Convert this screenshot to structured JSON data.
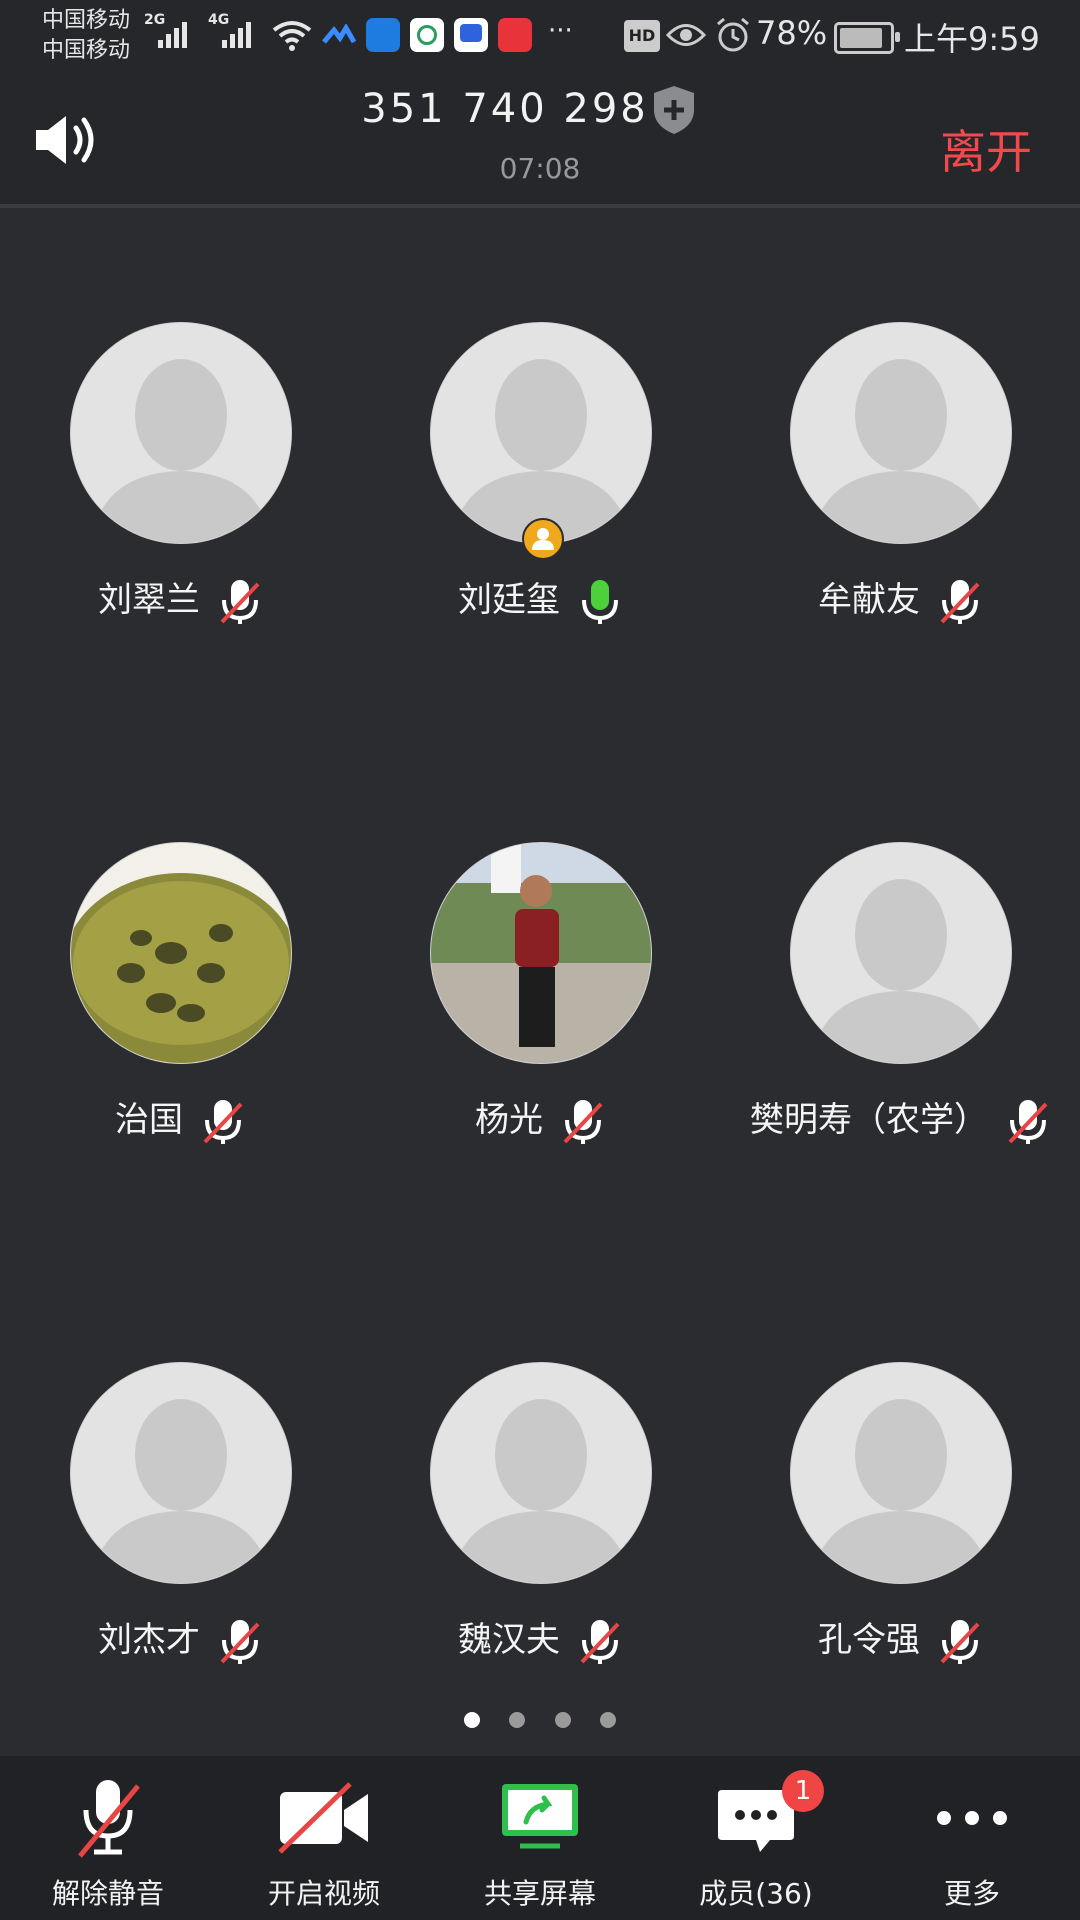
{
  "status_bar": {
    "carrier_1": "中国移动",
    "carrier_2": "中国移动",
    "net_1": "2G",
    "net_2": "4G",
    "battery": "78%",
    "time": "上午9:59",
    "hd": "HD"
  },
  "header": {
    "meeting_id": "351 740 298",
    "duration": "07:08",
    "leave_label": "离开"
  },
  "participants": [
    {
      "name": "刘翠兰",
      "mic": "muted",
      "avatar": "default"
    },
    {
      "name": "刘廷玺",
      "mic": "active",
      "avatar": "default",
      "host": true
    },
    {
      "name": "牟献友",
      "mic": "muted",
      "avatar": "default"
    },
    {
      "name": "治国",
      "mic": "muted",
      "avatar": "photo-tea"
    },
    {
      "name": "杨光",
      "mic": "muted",
      "avatar": "photo-man"
    },
    {
      "name": "樊明寿（农学）",
      "mic": "muted",
      "avatar": "default"
    },
    {
      "name": "刘杰才",
      "mic": "muted",
      "avatar": "default"
    },
    {
      "name": "魏汉夫",
      "mic": "muted",
      "avatar": "default"
    },
    {
      "name": "孔令强",
      "mic": "muted",
      "avatar": "default"
    }
  ],
  "pagination": {
    "pages": 4,
    "current": 1
  },
  "toolbar": {
    "unmute": "解除静音",
    "video": "开启视频",
    "share": "共享屏幕",
    "members": "成员(36)",
    "members_badge": "1",
    "more": "更多"
  },
  "colors": {
    "leave": "#f24a4a",
    "mic_active": "#4cd13c",
    "muted_slash": "#e84545",
    "share_green": "#2fbf4d",
    "host_badge": "#f0a81e"
  }
}
